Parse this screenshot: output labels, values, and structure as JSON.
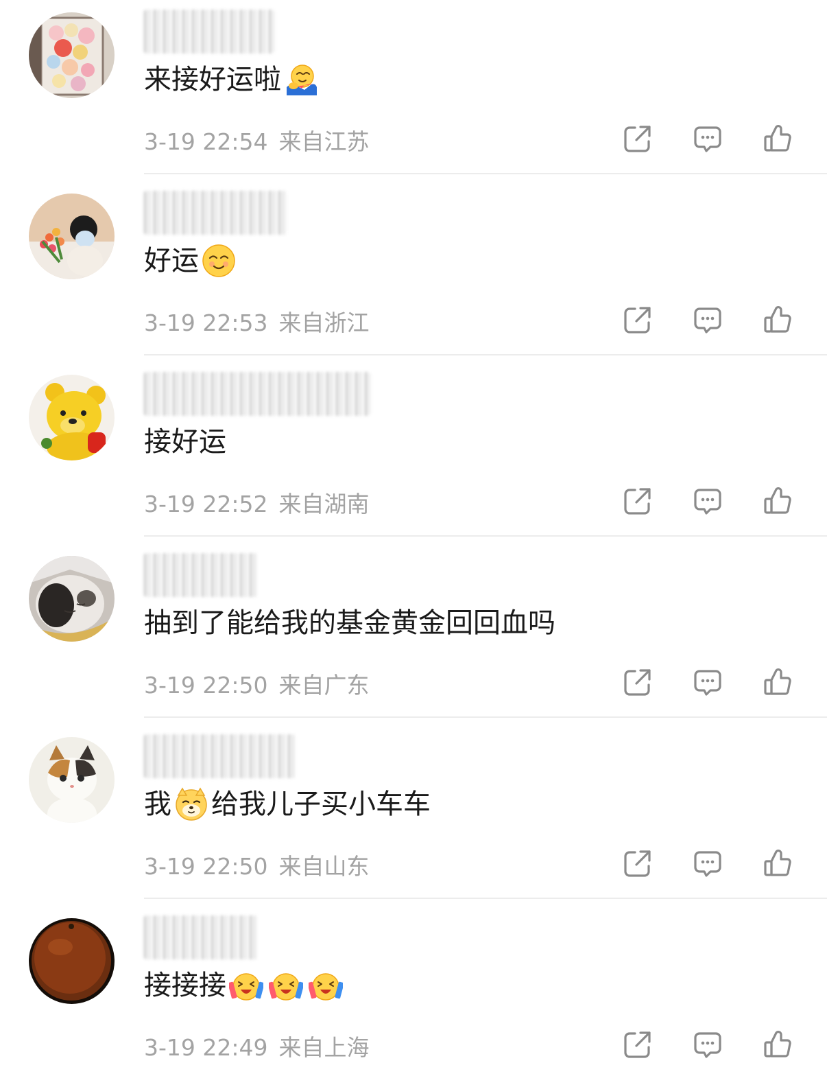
{
  "comments": [
    {
      "content": "来接好运啦",
      "emoji_after": "hug-emoji",
      "time": "3-19 22:54",
      "location": "来自江苏",
      "avatar": "balloons-avatar"
    },
    {
      "content": "好运",
      "emoji_after": "smile-emoji",
      "time": "3-19 22:53",
      "location": "来自浙江",
      "avatar": "flowers-girl-avatar"
    },
    {
      "content": "接好运",
      "time": "3-19 22:52",
      "location": "来自湖南",
      "avatar": "yellow-bear-avatar"
    },
    {
      "content": "抽到了能给我的基金黄金回回血吗",
      "time": "3-19 22:50",
      "location": "来自广东",
      "avatar": "sleeping-cat-avatar"
    },
    {
      "content_before": "我",
      "content_after": "给我儿子买小车车",
      "emoji_mid": "doge-emoji",
      "time": "3-19 22:50",
      "location": "来自山东",
      "avatar": "calico-cat-avatar"
    },
    {
      "content": "接接接",
      "emoji_after": "cheer-emoji",
      "emoji_count": 3,
      "time": "3-19 22:49",
      "location": "来自上海",
      "avatar": "orange-avatar"
    }
  ],
  "actions": {
    "share_icon": "share-icon",
    "reply_icon": "comment-icon",
    "like_icon": "thumbs-up-icon"
  },
  "colors": {
    "text": "#1a1a1a",
    "meta": "#a3a3a3",
    "icon": "#8a8a8a",
    "divider": "#ececec"
  }
}
